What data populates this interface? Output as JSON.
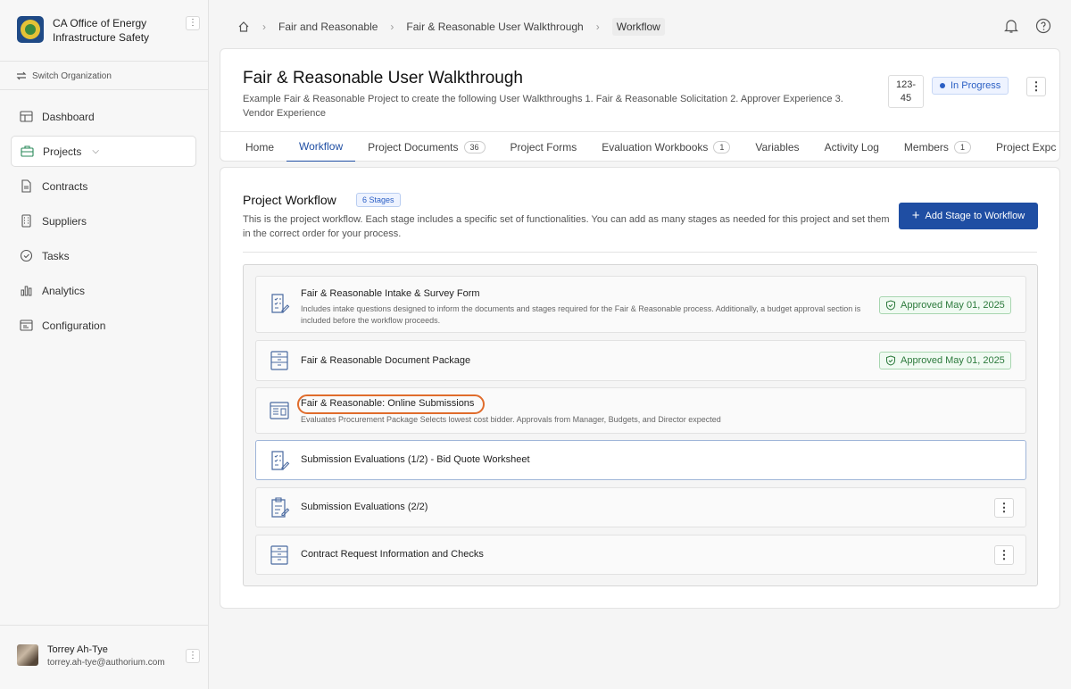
{
  "sidebar": {
    "org_name": "CA Office of Energy Infrastructure Safety",
    "switch_org": "Switch Organization",
    "items": [
      {
        "label": "Dashboard",
        "icon": "dashboard-icon"
      },
      {
        "label": "Projects",
        "icon": "briefcase-icon"
      },
      {
        "label": "Contracts",
        "icon": "document-icon"
      },
      {
        "label": "Suppliers",
        "icon": "building-icon"
      },
      {
        "label": "Tasks",
        "icon": "check-circle-icon"
      },
      {
        "label": "Analytics",
        "icon": "bar-chart-icon"
      },
      {
        "label": "Configuration",
        "icon": "settings-panel-icon"
      }
    ],
    "user": {
      "name": "Torrey Ah-Tye",
      "email": "torrey.ah-tye@authorium.com"
    }
  },
  "breadcrumb": [
    "Fair and Reasonable",
    "Fair & Reasonable User Walkthrough",
    "Workflow"
  ],
  "project": {
    "title": "Fair & Reasonable User Walkthrough",
    "description": "Example Fair & Reasonable Project to create the following User Walkthroughs 1. Fair & Reasonable Solicitation 2. Approver Experience 3. Vendor Experience",
    "id_line1": "123-",
    "id_line2": "45",
    "status": "In Progress"
  },
  "tabs": [
    {
      "label": "Home",
      "count": ""
    },
    {
      "label": "Workflow",
      "count": ""
    },
    {
      "label": "Project Documents",
      "count": "36"
    },
    {
      "label": "Project Forms",
      "count": ""
    },
    {
      "label": "Evaluation Workbooks",
      "count": "1"
    },
    {
      "label": "Variables",
      "count": ""
    },
    {
      "label": "Activity Log",
      "count": ""
    },
    {
      "label": "Members",
      "count": "1"
    },
    {
      "label": "Project Expc",
      "count": ""
    }
  ],
  "workflow": {
    "title": "Project Workflow",
    "stages_badge": "6 Stages",
    "description": "This is the project workflow. Each stage includes a specific set of functionalities. You can add as many stages as needed for this project and set them in the correct order for your process.",
    "add_button": "Add Stage to Workflow",
    "stages": [
      {
        "title": "Fair & Reasonable Intake & Survey Form",
        "description": "Includes intake questions designed to inform the documents and stages required for the Fair & Reasonable process. Additionally, a budget approval section is included before the workflow proceeds.",
        "status": "Approved May 01, 2025"
      },
      {
        "title": "Fair & Reasonable Document Package",
        "description": "",
        "status": "Approved May 01, 2025"
      },
      {
        "title": "Fair & Reasonable: Online Submissions",
        "description": "Evaluates Procurement Package Selects lowest cost bidder. Approvals from Manager, Budgets, and Director expected",
        "status": ""
      },
      {
        "title": "Submission Evaluations (1/2) - Bid Quote Worksheet",
        "description": "",
        "status": ""
      },
      {
        "title": "Submission Evaluations (2/2)",
        "description": "",
        "status": ""
      },
      {
        "title": "Contract Request Information and Checks",
        "description": "",
        "status": ""
      }
    ]
  },
  "colors": {
    "accent": "#1f4ea3",
    "approved": "#2c7a3c",
    "highlight": "#e06c2c"
  }
}
